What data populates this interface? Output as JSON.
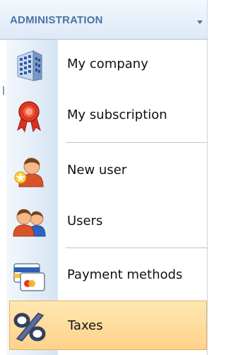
{
  "header": {
    "title": "ADMINISTRATION"
  },
  "menu": {
    "items": [
      {
        "label": "My company",
        "icon": "building-icon"
      },
      {
        "label": "My subscription",
        "icon": "award-ribbon-icon"
      },
      {
        "label": "New user",
        "icon": "add-user-icon"
      },
      {
        "label": "Users",
        "icon": "users-icon"
      },
      {
        "label": "Payment methods",
        "icon": "credit-card-icon"
      },
      {
        "label": "Taxes",
        "icon": "percent-icon",
        "selected": true
      }
    ]
  },
  "colors": {
    "header_text": "#4a73a6",
    "selection_background": "#ffd28b",
    "selection_border": "#e0b65c"
  }
}
